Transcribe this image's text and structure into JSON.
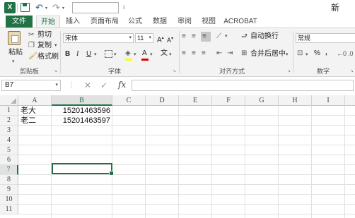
{
  "qat": {
    "app_letter": "X",
    "undo": "↶",
    "redo": "↷",
    "dropdown": "▾",
    "filename": "ⅰ",
    "brand": "新"
  },
  "tabs": [
    "文件",
    "开始",
    "插入",
    "页面布局",
    "公式",
    "数据",
    "审阅",
    "视图",
    "ACROBAT"
  ],
  "ribbon": {
    "clipboard": {
      "paste": "粘贴",
      "cut": "剪切",
      "copy": "复制",
      "format_painter": "格式刷",
      "label": "剪贴板"
    },
    "font": {
      "name": "宋体",
      "size": "11",
      "grow": "A",
      "shrink": "A",
      "bold": "B",
      "italic": "I",
      "underline": "U",
      "font_color": "A",
      "phonetic": "文",
      "label": "字体"
    },
    "alignment": {
      "wrap": "自动换行",
      "merge": "合并后居中",
      "label": "对齐方式"
    },
    "number": {
      "format": "常规",
      "percent": "%",
      "comma": ",",
      "label": "数字"
    }
  },
  "formula_bar": {
    "name_box": "B7",
    "cancel": "✕",
    "enter": "✓",
    "fx": "fx",
    "content": ""
  },
  "sheet": {
    "columns": [
      "A",
      "B",
      "C",
      "D",
      "E",
      "F",
      "G",
      "H",
      "I"
    ],
    "rows": [
      "1",
      "2",
      "3",
      "4",
      "5",
      "6",
      "7",
      "8",
      "9",
      "10",
      "11"
    ],
    "cells": {
      "A1": "老大",
      "B1": "15201463596",
      "A2": "老二",
      "B2": "15201463597"
    },
    "selected": "B7"
  },
  "colors": {
    "accent": "#217346"
  }
}
